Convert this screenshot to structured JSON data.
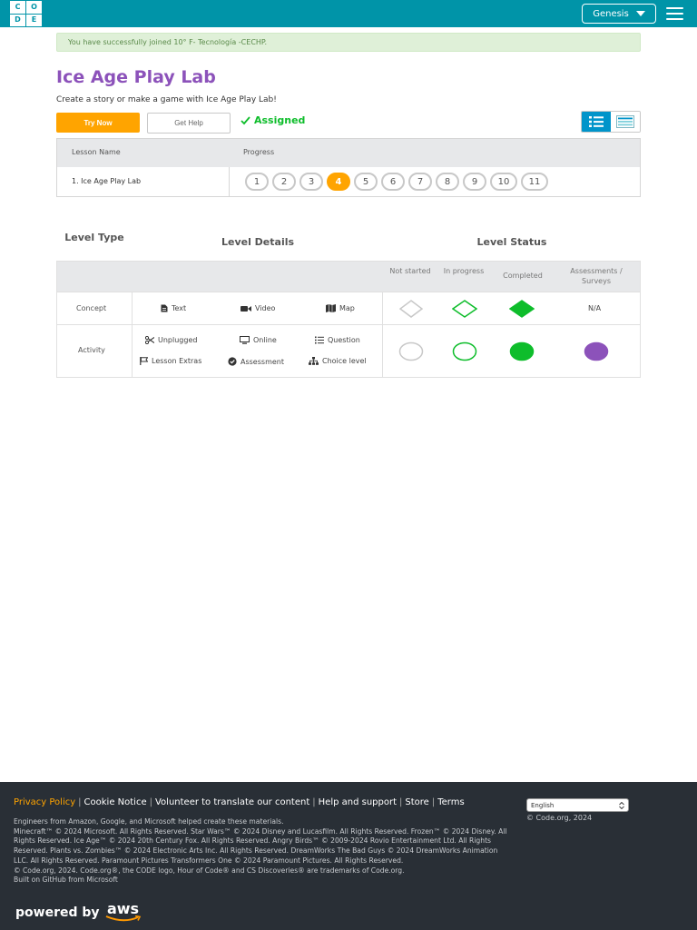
{
  "header": {
    "logo_letters": [
      "C",
      "O",
      "D",
      "E"
    ],
    "account_label": "Genesis",
    "brand_color": "#0094a8"
  },
  "alert": {
    "text": "You have successfully joined 10° F- Tecnología -CECHP."
  },
  "page": {
    "title": "Ice Age Play Lab",
    "subtitle": "Create a story or make a game with Ice Age Play Lab!",
    "try_now": "Try Now",
    "get_help": "Get Help",
    "assigned": "Assigned"
  },
  "lesson_table": {
    "headers": [
      "Lesson Name",
      "Progress"
    ],
    "row": {
      "name": "1. Ice Age Play Lab",
      "levels": [
        "1",
        "2",
        "3",
        "4",
        "5",
        "6",
        "7",
        "8",
        "9",
        "10",
        "11"
      ],
      "current_level": "4"
    }
  },
  "legend": {
    "col_titles": [
      "Level Type",
      "Level Details",
      "Level Status"
    ],
    "status_headers": [
      "Not started",
      "In progress",
      "Completed",
      "Assessments / Surveys"
    ],
    "rows": [
      {
        "type": "Concept",
        "details": [
          "Text",
          "Video",
          "Map"
        ],
        "assessment": "N/A"
      },
      {
        "type": "Activity",
        "details": [
          "Unplugged",
          "Online",
          "Question",
          "Lesson Extras",
          "Assessment",
          "Choice level"
        ]
      }
    ],
    "colors": {
      "in_progress": "#0ebd2b",
      "completed": "#0ebd2b",
      "assessment": "#8c52ba",
      "not_started": "#c8c8c8"
    }
  },
  "footer": {
    "links": [
      "Privacy Policy",
      "Cookie Notice",
      "Volunteer to translate our content",
      "Help and support",
      "Store",
      "Terms"
    ],
    "credits": [
      "Engineers from Amazon, Google, and Microsoft helped create these materials.",
      "Minecraft™ © 2024 Microsoft. All Rights Reserved. Star Wars™ © 2024 Disney and Lucasfilm. All Rights Reserved. Frozen™ © 2024 Disney. All Rights Reserved. Ice Age™ © 2024 20th Century Fox. All Rights Reserved. Angry Birds™ © 2009-2024 Rovio Entertainment Ltd. All Rights Reserved. Plants vs. Zombies™ © 2024 Electronic Arts Inc. All Rights Reserved. DreamWorks The Bad Guys © 2024 DreamWorks Animation LLC. All Rights Reserved. Paramount Pictures Transformers One © 2024 Paramount Pictures. All Rights Reserved.",
      "© Code.org, 2024. Code.org®, the CODE logo, Hour of Code® and CS Discoveries® are trademarks of Code.org.",
      "Built on GitHub from Microsoft"
    ],
    "language": "English",
    "copyright": "© Code.org, 2024",
    "powered_by": "powered by",
    "aws": "aws"
  }
}
